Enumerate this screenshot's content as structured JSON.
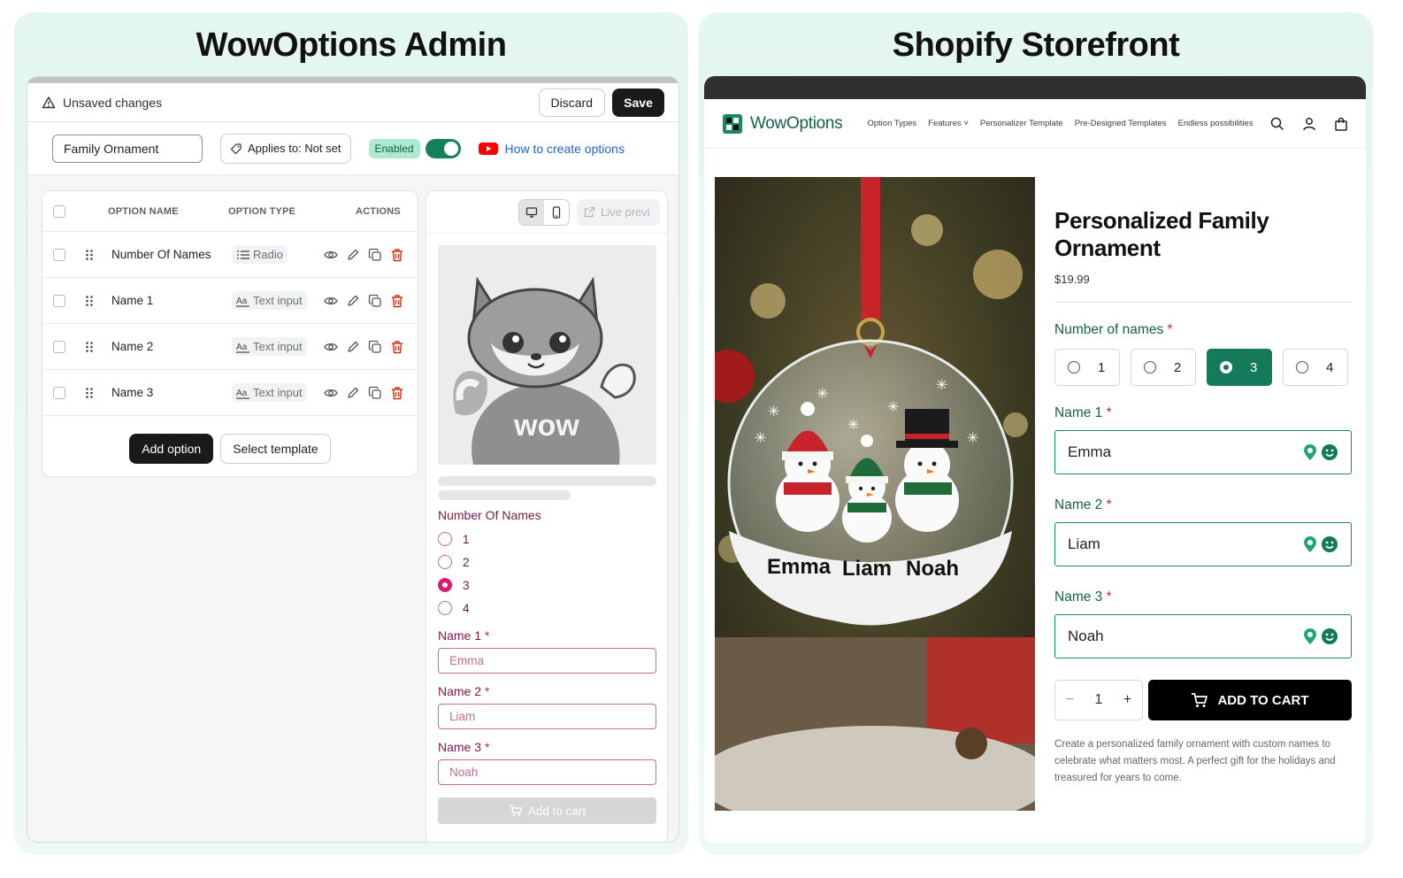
{
  "admin": {
    "heading": "WowOptions Admin",
    "unsaved_label": "Unsaved changes",
    "discard_label": "Discard",
    "save_label": "Save",
    "product_name": "Family Ornament",
    "applies_to": "Applies to: Not set",
    "status_badge": "Enabled",
    "enabled": true,
    "howto_link": "How to create options",
    "table": {
      "headers": [
        "OPTION NAME",
        "OPTION TYPE",
        "ACTIONS"
      ],
      "rows": [
        {
          "name": "Number Of Names",
          "type": "Radio",
          "type_icon": "list-icon"
        },
        {
          "name": "Name 1",
          "type": "Text input",
          "type_icon": "text-input-icon"
        },
        {
          "name": "Name 2",
          "type": "Text input",
          "type_icon": "text-input-icon"
        },
        {
          "name": "Name 3",
          "type": "Text input",
          "type_icon": "text-input-icon"
        }
      ]
    },
    "add_option_label": "Add option",
    "select_template_label": "Select template",
    "preview": {
      "live_preview_label": "Live previ",
      "mascot_text": "wow",
      "radio_group_label": "Number Of Names",
      "radio_options": [
        "1",
        "2",
        "3",
        "4"
      ],
      "radio_selected": "3",
      "fields": [
        {
          "label": "Name 1",
          "required_mark": "*",
          "value": "Emma"
        },
        {
          "label": "Name 2",
          "required_mark": "*",
          "value": "Liam"
        },
        {
          "label": "Name 3",
          "required_mark": "*",
          "value": "Noah"
        }
      ],
      "add_to_cart_label": "Add to cart"
    }
  },
  "store": {
    "heading": "Shopify Storefront",
    "brand": "WowOptions",
    "nav": [
      "Option Types",
      "Features",
      "Personalizer Template",
      "Pre-Designed Templates",
      "Endless possibilities"
    ],
    "nav_features_caret": "˅",
    "product_title": "Personalized Family Ornament",
    "price": "$19.99",
    "ornament_names": [
      "Emma",
      "Liam",
      "Noah"
    ],
    "number_label": "Number of names",
    "required_mark": "*",
    "number_options": [
      "1",
      "2",
      "3",
      "4"
    ],
    "number_selected": "3",
    "fields": [
      {
        "label": "Name 1",
        "value": "Emma"
      },
      {
        "label": "Name 2",
        "value": "Liam"
      },
      {
        "label": "Name 3",
        "value": "Noah"
      }
    ],
    "quantity": "1",
    "qty_minus": "−",
    "qty_plus": "+",
    "add_to_cart_label": "ADD TO CART",
    "description": "Create a personalized family ornament with custom names to celebrate what matters most. A perfect gift for the holidays and treasured for years to come.",
    "accent_color": "#157a5a"
  }
}
